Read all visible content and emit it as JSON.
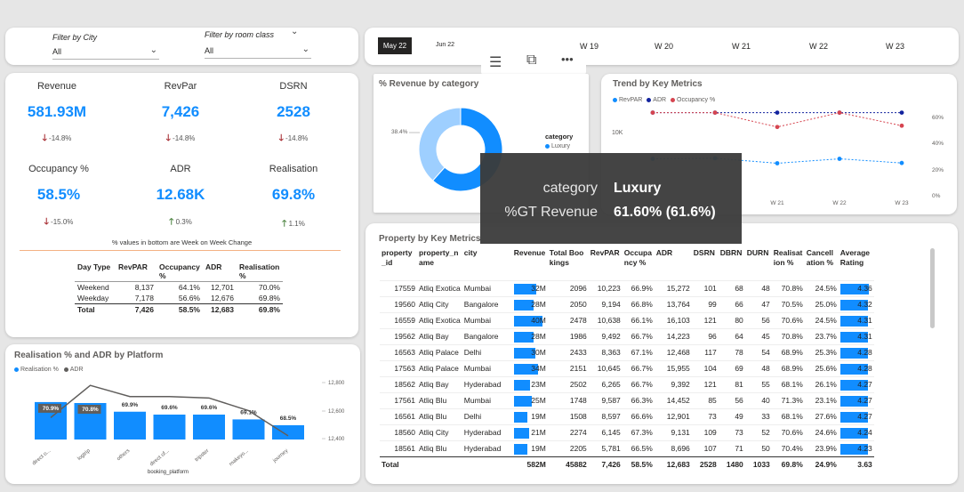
{
  "filters": {
    "city_label": "Filter by City",
    "city_value": "All",
    "room_label": "Filter by room class",
    "room_value": "All"
  },
  "timeline": {
    "selected": "May 22",
    "items": [
      "Jun 22",
      "W 19",
      "W 20",
      "W 21",
      "W 22",
      "W 23"
    ]
  },
  "kpis": [
    {
      "label": "Revenue",
      "value": "581.93M",
      "delta": "-14.8%",
      "dir": "down"
    },
    {
      "label": "RevPar",
      "value": "7,426",
      "delta": "-14.8%",
      "dir": "down"
    },
    {
      "label": "DSRN",
      "value": "2528",
      "delta": "-14.8%",
      "dir": "down"
    },
    {
      "label": "Occupancy %",
      "value": "58.5%",
      "delta": "-15.0%",
      "dir": "down"
    },
    {
      "label": "ADR",
      "value": "12.68K",
      "delta": "0.3%",
      "dir": "up"
    },
    {
      "label": "Realisation",
      "value": "69.8%",
      "delta": "1.1%",
      "dir": "up"
    }
  ],
  "kpi_note": "% values in bottom are Week on Week Change",
  "day_table": {
    "headers": [
      "Day Type",
      "RevPAR",
      "Occupancy %",
      "ADR",
      "Realisation %"
    ],
    "rows": [
      [
        "Weekend",
        "8,137",
        "64.1%",
        "12,701",
        "70.0%"
      ],
      [
        "Weekday",
        "7,178",
        "56.6%",
        "12,676",
        "69.8%"
      ]
    ],
    "total": [
      "Total",
      "7,426",
      "58.5%",
      "12,683",
      "69.8%"
    ]
  },
  "platform_chart": {
    "title": "Realisation % and ADR by Platform",
    "legend": [
      "Realisation %",
      "ADR"
    ],
    "xlabel": "booking_platform",
    "y2_ticks": [
      "12,800",
      "12,600",
      "12,400"
    ],
    "colors": {
      "bar": "#118DFF",
      "line": "#605e5c"
    }
  },
  "revenue_category": {
    "title": "% Revenue by category",
    "legend_title": "category",
    "legend_items": [
      "Luxury"
    ],
    "label_small": "38.4%",
    "colors": {
      "luxury": "#118DFF",
      "business": "#9ECFFF"
    }
  },
  "trend": {
    "title": "Trend by Key Metrics",
    "legend": [
      "RevPAR",
      "ADR",
      "Occupancy %"
    ],
    "y_left": "10K",
    "y_right": [
      "60%",
      "40%",
      "20%",
      "0%"
    ],
    "x_labels": [
      "W 21",
      "W 22",
      "W 23"
    ],
    "colors": {
      "revpar": "#118DFF",
      "adr": "#12239E",
      "occ": "#D64550"
    }
  },
  "tooltip": {
    "k1": "category",
    "v1": "Luxury",
    "k2": "%GT Revenue",
    "v2": "61.60% (61.6%)"
  },
  "property_table": {
    "title": "Property by Key Metrics",
    "headers": [
      "property_id",
      "property_name",
      "city",
      "Revenue",
      "Total Bookings",
      "RevPAR",
      "Occupancy %",
      "ADR",
      "DSRN",
      "DBRN",
      "DURN",
      "Realisation %",
      "Cancellation %",
      "Average Rating"
    ],
    "rows": [
      [
        "17559",
        "Atliq Exotica",
        "Mumbai",
        "32M",
        "2096",
        "10,223",
        "66.9%",
        "15,272",
        "101",
        "68",
        "48",
        "70.8%",
        "24.5%",
        "4.36"
      ],
      [
        "19560",
        "Atliq City",
        "Bangalore",
        "28M",
        "2050",
        "9,194",
        "66.8%",
        "13,764",
        "99",
        "66",
        "47",
        "70.5%",
        "25.0%",
        "4.32"
      ],
      [
        "16559",
        "Atliq Exotica",
        "Mumbai",
        "40M",
        "2478",
        "10,638",
        "66.1%",
        "16,103",
        "121",
        "80",
        "56",
        "70.6%",
        "24.5%",
        "4.31"
      ],
      [
        "19562",
        "Atliq Bay",
        "Bangalore",
        "28M",
        "1986",
        "9,492",
        "66.7%",
        "14,223",
        "96",
        "64",
        "45",
        "70.8%",
        "23.7%",
        "4.31"
      ],
      [
        "16563",
        "Atliq Palace",
        "Delhi",
        "30M",
        "2433",
        "8,363",
        "67.1%",
        "12,468",
        "117",
        "78",
        "54",
        "68.9%",
        "25.3%",
        "4.28"
      ],
      [
        "17563",
        "Atliq Palace",
        "Mumbai",
        "34M",
        "2151",
        "10,645",
        "66.7%",
        "15,955",
        "104",
        "69",
        "48",
        "68.9%",
        "25.6%",
        "4.28"
      ],
      [
        "18562",
        "Atliq Bay",
        "Hyderabad",
        "23M",
        "2502",
        "6,265",
        "66.7%",
        "9,392",
        "121",
        "81",
        "55",
        "68.1%",
        "26.1%",
        "4.27"
      ],
      [
        "17561",
        "Atliq Blu",
        "Mumbai",
        "25M",
        "1748",
        "9,587",
        "66.3%",
        "14,452",
        "85",
        "56",
        "40",
        "71.3%",
        "23.1%",
        "4.27"
      ],
      [
        "16561",
        "Atliq Blu",
        "Delhi",
        "19M",
        "1508",
        "8,597",
        "66.6%",
        "12,901",
        "73",
        "49",
        "33",
        "68.1%",
        "27.6%",
        "4.27"
      ],
      [
        "18560",
        "Atliq City",
        "Hyderabad",
        "21M",
        "2274",
        "6,145",
        "67.3%",
        "9,131",
        "109",
        "73",
        "52",
        "70.6%",
        "24.6%",
        "4.24"
      ],
      [
        "18561",
        "Atliq Blu",
        "Hyderabad",
        "19M",
        "2205",
        "5,781",
        "66.5%",
        "8,696",
        "107",
        "71",
        "50",
        "70.4%",
        "23.9%",
        "4.23"
      ]
    ],
    "total": [
      "Total",
      "",
      "",
      "582M",
      "45882",
      "7,426",
      "58.5%",
      "12,683",
      "2528",
      "1480",
      "1033",
      "69.8%",
      "24.9%",
      "3.63"
    ]
  },
  "chart_data": [
    {
      "type": "bar",
      "title": "Realisation % and ADR by Platform",
      "categories": [
        "direct o...",
        "logtrip",
        "others",
        "direct of...",
        "tripster",
        "makeyo...",
        "journey"
      ],
      "series": [
        {
          "name": "Realisation %",
          "values": [
            70.9,
            70.8,
            69.9,
            69.6,
            69.6,
            69.1,
            68.5
          ]
        },
        {
          "name": "ADR",
          "values": [
            12550,
            12780,
            12700,
            12700,
            12690,
            12600,
            12420
          ]
        }
      ],
      "value_labels": [
        "70.9%",
        "70.8%",
        "69.9%",
        "69.6%",
        "69.6%",
        "69.1%",
        "68.5%"
      ],
      "xlabel": "booking_platform",
      "y2lim": [
        12400,
        12800
      ]
    },
    {
      "type": "pie",
      "title": "% Revenue by category",
      "categories": [
        "Luxury",
        "Business"
      ],
      "values": [
        61.6,
        38.4
      ]
    },
    {
      "type": "line",
      "title": "Trend by Key Metrics",
      "x": [
        "W 19",
        "W 20",
        "W 21",
        "W 22",
        "W 23"
      ],
      "series": [
        {
          "name": "RevPAR",
          "axis": "left",
          "values": [
            7800,
            7850,
            7400,
            7800,
            7426
          ]
        },
        {
          "name": "ADR",
          "axis": "right",
          "values": [
            63,
            63,
            63,
            63,
            63
          ]
        },
        {
          "name": "Occupancy %",
          "axis": "right",
          "values": [
            63,
            63,
            52,
            63,
            53
          ]
        }
      ]
    }
  ]
}
